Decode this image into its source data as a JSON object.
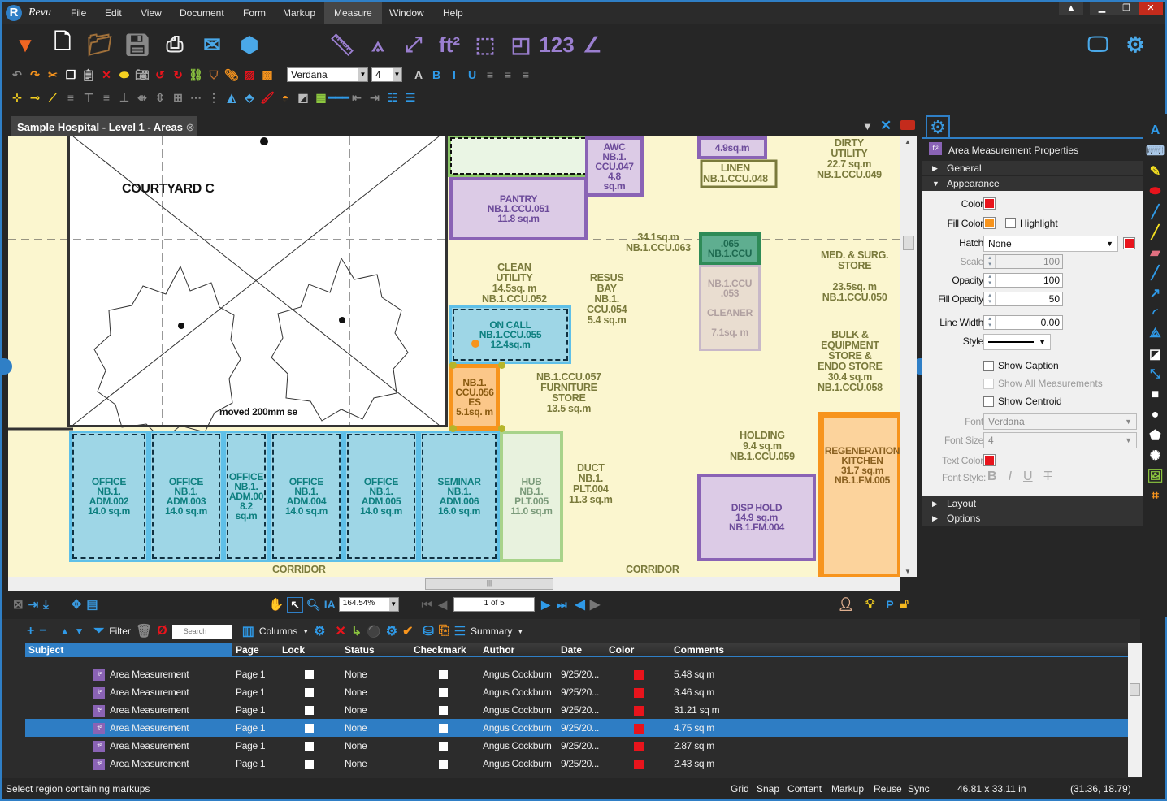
{
  "app": {
    "logo_text": "Revu",
    "accent": "#2f7fc6"
  },
  "menu": [
    "File",
    "Edit",
    "View",
    "Document",
    "Form",
    "Markup",
    "Measure",
    "Window",
    "Help"
  ],
  "menu_active": "Measure",
  "window_controls": [
    "minimize",
    "restore",
    "close"
  ],
  "toolbar1_left": [
    "dropdown-arrow-icon",
    "new-document-icon",
    "open-folder-icon",
    "save-icon",
    "print-icon",
    "email-icon",
    "revu-3d-icon"
  ],
  "toolbar1_measure": [
    "length-ruler-icon",
    "calibrate-caliper-icon",
    "polylength-icon",
    "area-ft2-icon",
    "volume-icon",
    "cutout-icon",
    "count-icon",
    "angle-icon"
  ],
  "toolbar1_count_label": "123",
  "toolbar1_right": [
    "monitor-icon",
    "gear-icon"
  ],
  "toolbar2_left": [
    "undo-icon",
    "redo-icon",
    "cut-icon",
    "copy-icon",
    "paste-icon",
    "delete-icon",
    "flatten-icon",
    "snapshot-icon",
    "rotate-left-icon",
    "rotate-right-icon",
    "link-icon",
    "stamp-icon",
    "attach-icon",
    "erase-content-icon",
    "cut-content-icon"
  ],
  "font": {
    "family": "Verdana",
    "size": "4"
  },
  "toolbar2_right": [
    "font-color-icon",
    "bold-icon",
    "italic-icon",
    "underline-icon",
    "align-left-icon",
    "align-center-icon",
    "align-right-icon"
  ],
  "toolbar3": [
    "add-vertex-icon",
    "remove-vertex-icon",
    "edit-vertex-icon",
    "align-left-icon",
    "align-top-icon",
    "align-right-icon",
    "align-bottom-icon",
    "distribute-h-icon",
    "distribute-v-icon",
    "center-icon",
    "space-h-icon",
    "space-v-icon",
    "flip-h-icon",
    "flip-v-icon",
    "line-color-icon",
    "fill-color-icon",
    "opacity-icon",
    "hatch-icon",
    "line-style-icon",
    "line-start-icon",
    "line-end-icon",
    "line-width-icon",
    "line-weight-icon"
  ],
  "document_tab": "Sample Hospital - Level 1 - Areas",
  "drawing": {
    "courtyard": "COURTYARD C",
    "note": "moved 200mm se",
    "corridor_labels": [
      "CORRIDOR",
      "CORRIDOR"
    ],
    "rooms": [
      {
        "label": "AWC\nNB.1.\nCCU.047\n4.8\nsq.m"
      },
      {
        "label": "4.9sq.m"
      },
      {
        "label": "PANTRY\nNB.1.CCU.051\n11.8 sq.m"
      },
      {
        "label": ".065\nNB.1.CCU"
      },
      {
        "label": "NB.1.CCU\n.053\n\nCLEANER\n\n7.1sq. m"
      },
      {
        "label": "ON CALL\nNB.1.CCU.055\n12.4sq.m"
      },
      {
        "label": "NB.1.\nCCU.056\nES\n5.1sq. m"
      },
      {
        "label": "OFFICE\nNB.1.\nADM.002\n14.0 sq.m"
      },
      {
        "label": "OFFICE\nNB.1.\nADM.003\n14.0 sq.m"
      },
      {
        "label": "OFFICE\nNB.1.\nADM.00\n8.2\nsq.m"
      },
      {
        "label": "OFFICE\nNB.1.\nADM.004\n14.0 sq.m"
      },
      {
        "label": "OFFICE\nNB.1.\nADM.005\n14.0 sq.m"
      },
      {
        "label": "SEMINAR\nNB.1.\nADM.006\n16.0 sq.m"
      },
      {
        "label": "HUB\nNB.1.\nPLT.005\n11.0 sq.m"
      },
      {
        "label": "DISP HOLD\n14.9 sq.m\nNB.1.FM.004"
      },
      {
        "label": "REGENERATION\nKITCHEN\n31.7 sq.m\nNB.1.FM.005"
      }
    ],
    "labels": [
      "LINEN\nNB.1.CCU.048",
      "DIRTY\nUTILITY\n22.7 sq.m\nNB.1.CCU.049",
      "34.1sq.m\nNB.1.CCU.063",
      "CLEAN\nUTILITY\n14.5sq. m\nNB.1.CCU.052",
      "RESUS\nBAY\nNB.1.\nCCU.054\n5.4 sq.m",
      "MED. & SURG.\nSTORE\n\n23.5sq. m\nNB.1.CCU.050",
      "NB.1.CCU.057\nFURNITURE\nSTORE\n13.5 sq.m",
      "BULK &\nEQUIPMENT\nSTORE &\nENDO STORE\n30.4 sq.m\nNB.1.CCU.058",
      "HOLDING\n9.4 sq.m\nNB.1.CCU.059",
      "DUCT\nNB.1.\nPLT.004\n11.3 sq.m"
    ]
  },
  "navbar": {
    "zoom": "164.54%",
    "page": "1 of 5"
  },
  "properties": {
    "title": "Area Measurement Properties",
    "sections": {
      "general": "General",
      "appearance": "Appearance",
      "layout": "Layout",
      "options": "Options"
    },
    "color_label": "Color:",
    "color": "#e8141c",
    "fill_color_label": "Fill Color:",
    "fill_color": "#f7941d",
    "highlight_label": "Highlight",
    "highlight": false,
    "hatch_label": "Hatch:",
    "hatch": "None",
    "hatch_color": "#e8141c",
    "scale_label": "Scale:",
    "scale": "100",
    "opacity_label": "Opacity:",
    "opacity": "100",
    "fill_opacity_label": "Fill Opacity:",
    "fill_opacity": "50",
    "line_width_label": "Line Width:",
    "line_width": "0.00",
    "style_label": "Style:",
    "style": "solid",
    "show_caption": "Show Caption",
    "show_all_measurements": "Show All Measurements",
    "show_centroid": "Show Centroid",
    "font_label": "Font:",
    "font": "Verdana",
    "font_size_label": "Font Size:",
    "font_size": "4",
    "text_color_label": "Text Color:",
    "text_color": "#e8141c",
    "font_style_label": "Font Style:",
    "font_styles": [
      "B",
      "I",
      "U",
      "T"
    ]
  },
  "right_tools": [
    "text-icon",
    "typewriter-icon",
    "note-icon",
    "highlight-icon",
    "pen-icon",
    "highlighter-icon",
    "eraser-icon",
    "line-icon",
    "arrow-icon",
    "arc-icon",
    "polyline-icon",
    "callout-icon",
    "dimension-icon",
    "rectangle-icon",
    "ellipse-icon",
    "polygon-icon",
    "cloud-icon",
    "image-icon",
    "crop-icon"
  ],
  "markups": {
    "toolbar": {
      "filter": "Filter",
      "search_placeholder": "Search",
      "columns": "Columns",
      "summary": "Summary"
    },
    "columns": [
      "Subject",
      "Page",
      "Lock",
      "Status",
      "Checkmark",
      "Author",
      "Date",
      "Color",
      "Comments"
    ],
    "rows": [
      {
        "subject": "Area Measurement",
        "page": "Page 1",
        "status": "None",
        "author": "Angus Cockburn",
        "date": "9/25/20...",
        "color": "#e8141c",
        "comments": "5.48 sq m"
      },
      {
        "subject": "Area Measurement",
        "page": "Page 1",
        "status": "None",
        "author": "Angus Cockburn",
        "date": "9/25/20...",
        "color": "#e8141c",
        "comments": "3.46 sq m"
      },
      {
        "subject": "Area Measurement",
        "page": "Page 1",
        "status": "None",
        "author": "Angus Cockburn",
        "date": "9/25/20...",
        "color": "#e8141c",
        "comments": "31.21 sq m"
      },
      {
        "subject": "Area Measurement",
        "page": "Page 1",
        "status": "None",
        "author": "Angus Cockburn",
        "date": "9/25/20...",
        "color": "#e8141c",
        "comments": "4.75 sq m",
        "selected": true
      },
      {
        "subject": "Area Measurement",
        "page": "Page 1",
        "status": "None",
        "author": "Angus Cockburn",
        "date": "9/25/20...",
        "color": "#e8141c",
        "comments": "2.87 sq m"
      },
      {
        "subject": "Area Measurement",
        "page": "Page 1",
        "status": "None",
        "author": "Angus Cockburn",
        "date": "9/25/20...",
        "color": "#e8141c",
        "comments": "2.43 sq m"
      }
    ]
  },
  "status": {
    "message": "Select region containing markups",
    "toggles": [
      "Grid",
      "Snap",
      "Content",
      "Markup",
      "Reuse",
      "Sync"
    ],
    "page_size": "46.81 x 33.11 in",
    "coords": "(31.36, 18.79)"
  }
}
